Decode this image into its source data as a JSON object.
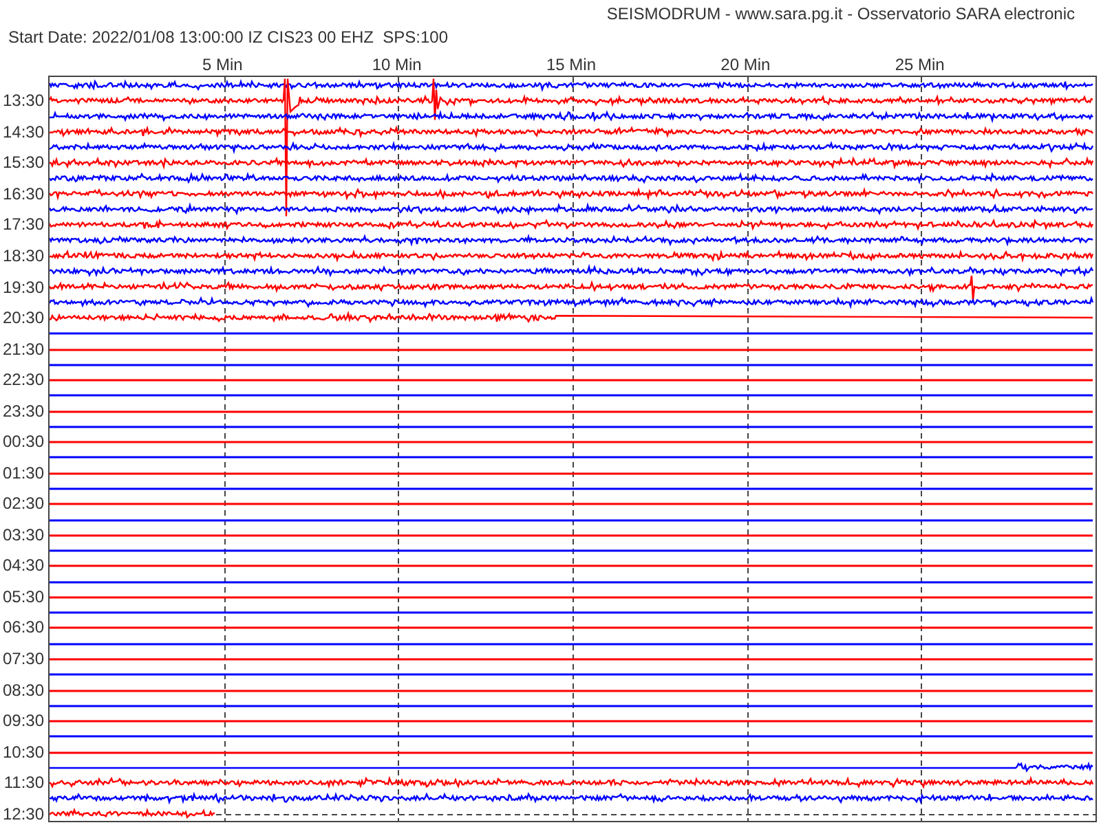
{
  "header": {
    "title": "SEISMODRUM - www.sara.pg.it - Osservatorio SARA electronic",
    "start_info": "Start Date: 2022/01/08 13:00:00 IZ CIS23 00 EHZ  SPS:100"
  },
  "plot": {
    "x_ticks": [
      "5 Min",
      "10 Min",
      "15 Min",
      "20 Min",
      "25 Min"
    ],
    "traces": [
      {
        "kind": "full",
        "color": "#0000ff"
      },
      {
        "kind": "quake",
        "color": "#ff0000",
        "label": "13:30"
      },
      {
        "kind": "full",
        "color": "#0000ff"
      },
      {
        "kind": "full",
        "color": "#ff0000",
        "label": "14:30"
      },
      {
        "kind": "full",
        "color": "#0000ff"
      },
      {
        "kind": "full",
        "color": "#ff0000",
        "label": "15:30"
      },
      {
        "kind": "full",
        "color": "#0000ff"
      },
      {
        "kind": "full",
        "color": "#ff0000",
        "label": "16:30"
      },
      {
        "kind": "full",
        "color": "#0000ff"
      },
      {
        "kind": "full",
        "color": "#ff0000",
        "label": "17:30"
      },
      {
        "kind": "full",
        "color": "#0000ff"
      },
      {
        "kind": "full",
        "color": "#ff0000",
        "label": "18:30"
      },
      {
        "kind": "full",
        "color": "#0000ff"
      },
      {
        "kind": "blip",
        "color": "#ff0000",
        "label": "19:30"
      },
      {
        "kind": "full",
        "color": "#0000ff"
      },
      {
        "kind": "ends",
        "color": "#ff0000",
        "label": "20:30"
      },
      {
        "kind": "flat",
        "color": "#0000ff"
      },
      {
        "kind": "flat",
        "color": "#ff0000",
        "label": "21:30"
      },
      {
        "kind": "flat",
        "color": "#0000ff"
      },
      {
        "kind": "flat",
        "color": "#ff0000",
        "label": "22:30"
      },
      {
        "kind": "flat",
        "color": "#0000ff"
      },
      {
        "kind": "flat",
        "color": "#ff0000",
        "label": "23:30"
      },
      {
        "kind": "flat",
        "color": "#0000ff"
      },
      {
        "kind": "flat",
        "color": "#ff0000",
        "label": "00:30"
      },
      {
        "kind": "flat",
        "color": "#0000ff"
      },
      {
        "kind": "flat",
        "color": "#ff0000",
        "label": "01:30"
      },
      {
        "kind": "flat",
        "color": "#0000ff"
      },
      {
        "kind": "flat",
        "color": "#ff0000",
        "label": "02:30"
      },
      {
        "kind": "flat",
        "color": "#0000ff"
      },
      {
        "kind": "flat",
        "color": "#ff0000",
        "label": "03:30"
      },
      {
        "kind": "flat",
        "color": "#0000ff"
      },
      {
        "kind": "flat",
        "color": "#ff0000",
        "label": "04:30"
      },
      {
        "kind": "flat",
        "color": "#0000ff"
      },
      {
        "kind": "flat",
        "color": "#ff0000",
        "label": "05:30"
      },
      {
        "kind": "flat",
        "color": "#0000ff"
      },
      {
        "kind": "flat",
        "color": "#ff0000",
        "label": "06:30"
      },
      {
        "kind": "flat",
        "color": "#0000ff"
      },
      {
        "kind": "flat",
        "color": "#ff0000",
        "label": "07:30"
      },
      {
        "kind": "flat",
        "color": "#0000ff"
      },
      {
        "kind": "flat",
        "color": "#ff0000",
        "label": "08:30"
      },
      {
        "kind": "flat",
        "color": "#0000ff"
      },
      {
        "kind": "flat",
        "color": "#ff0000",
        "label": "09:30"
      },
      {
        "kind": "flat",
        "color": "#0000ff"
      },
      {
        "kind": "flat",
        "color": "#ff0000",
        "label": "10:30"
      },
      {
        "kind": "starts",
        "color": "#0000ff"
      },
      {
        "kind": "full",
        "color": "#ff0000",
        "label": "11:30"
      },
      {
        "kind": "full",
        "color": "#0000ff"
      },
      {
        "kind": "cut",
        "color": "#ff0000",
        "label": "12:30"
      }
    ]
  }
}
